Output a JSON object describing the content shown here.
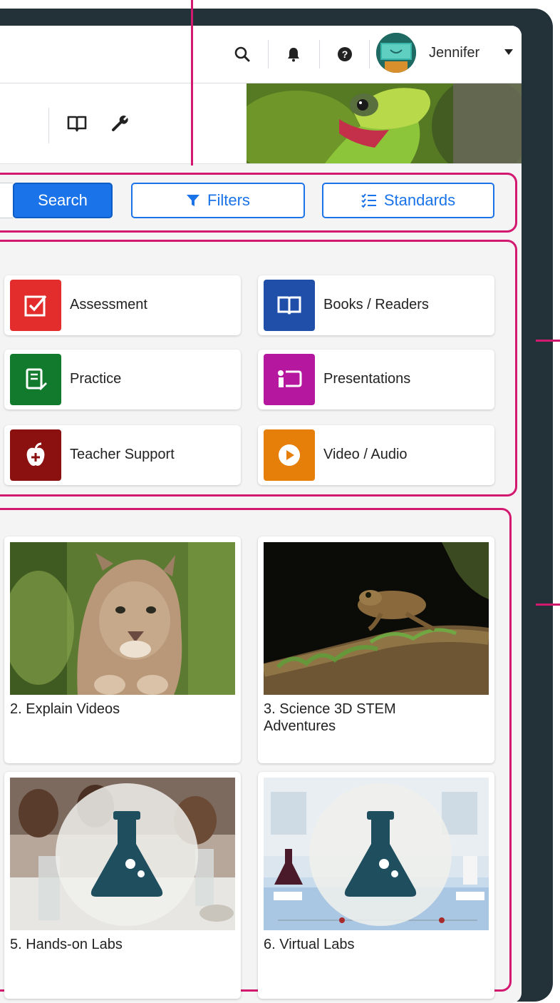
{
  "header": {
    "user_name": "Jennifer",
    "icons": [
      "search-icon",
      "bell-icon",
      "help-icon",
      "book-icon",
      "wrench-icon"
    ]
  },
  "search": {
    "button_label": "Search",
    "filters_label": "Filters",
    "standards_label": "Standards"
  },
  "categories": [
    {
      "label": "Assessment",
      "icon": "checkbox-icon",
      "color": "#e32c2c"
    },
    {
      "label": "Books / Readers",
      "icon": "open-book-icon",
      "color": "#1f4fa8"
    },
    {
      "label": "Practice",
      "icon": "practice-icon",
      "color": "#117a2c"
    },
    {
      "label": "Presentations",
      "icon": "presentation-icon",
      "color": "#b5179e"
    },
    {
      "label": "Teacher Support",
      "icon": "apple-icon",
      "color": "#8b1010"
    },
    {
      "label": "Video / Audio",
      "icon": "play-icon",
      "color": "#e67e0a"
    }
  ],
  "cards": [
    {
      "title": "2. Explain Videos"
    },
    {
      "title": "3. Science 3D STEM\n  Adventures"
    },
    {
      "title": "5. Hands-on Labs"
    },
    {
      "title": "6. Virtual Labs"
    }
  ],
  "colors": {
    "primary": "#1a73e8",
    "highlight": "#d3186f",
    "flask": "#1f4e5f"
  }
}
